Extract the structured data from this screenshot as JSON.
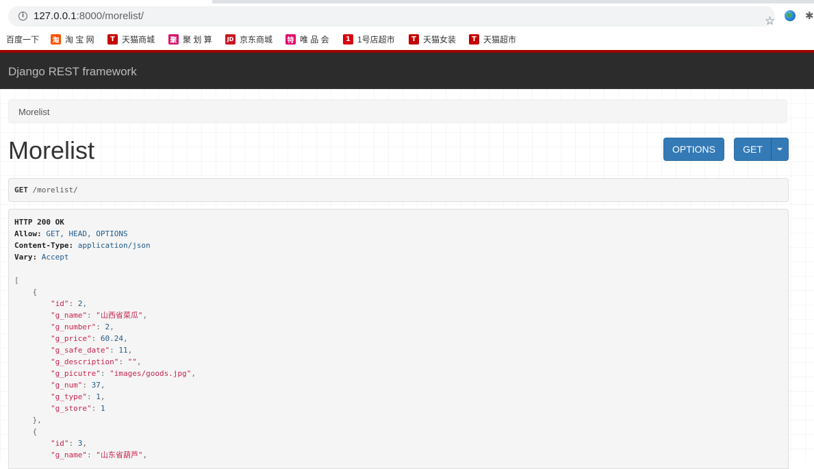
{
  "browser": {
    "url_host": "127.0.0.1",
    "url_path": ":8000/morelist/"
  },
  "bookmarks": [
    {
      "label": "百度一下",
      "icon": "",
      "color": ""
    },
    {
      "label": "淘 宝 网",
      "icon": "淘",
      "color": "#ff5000"
    },
    {
      "label": "天猫商城",
      "icon": "T",
      "color": "#c40000"
    },
    {
      "label": "聚 划 算",
      "icon": "聚",
      "color": "#d7166a"
    },
    {
      "label": "京东商城",
      "icon": "JD",
      "color": "#c91623"
    },
    {
      "label": "唯 品 会",
      "icon": "特",
      "color": "#e2006a"
    },
    {
      "label": "1号店超市",
      "icon": "1",
      "color": "#d7000f"
    },
    {
      "label": "天猫女装",
      "icon": "T",
      "color": "#c40000"
    },
    {
      "label": "天猫超市",
      "icon": "T",
      "color": "#c40000"
    }
  ],
  "navbar": {
    "brand": "Django REST framework"
  },
  "breadcrumb": {
    "current": "Morelist"
  },
  "page": {
    "title": "Morelist",
    "options_label": "OPTIONS",
    "get_label": "GET"
  },
  "request": {
    "method": "GET",
    "path": "/morelist/"
  },
  "response": {
    "status_line": "HTTP 200 OK",
    "headers": [
      {
        "name": "Allow:",
        "value": "GET, HEAD, OPTIONS"
      },
      {
        "name": "Content-Type:",
        "value": "application/json"
      },
      {
        "name": "Vary:",
        "value": "Accept"
      }
    ],
    "items": [
      {
        "id": "2",
        "g_name": "\"山西省菜瓜\"",
        "g_number": "2",
        "g_price": "60.24",
        "g_safe_date": "11",
        "g_description": "\"\"",
        "g_picutre": "\"images/goods.jpg\"",
        "g_num": "37",
        "g_type": "1",
        "g_store": "1"
      },
      {
        "id": "3",
        "g_name": "\"山东省葫芦\""
      }
    ]
  }
}
